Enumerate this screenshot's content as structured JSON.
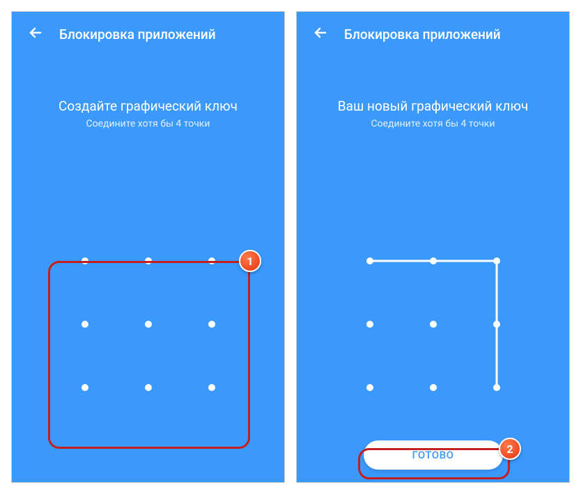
{
  "screen1": {
    "header_title": "Блокировка приложений",
    "main_title": "Создайте графический ключ",
    "subtitle": "Соедините хотя бы 4 точки"
  },
  "screen2": {
    "header_title": "Блокировка приложений",
    "main_title": "Ваш новый графический ключ",
    "subtitle": "Соедините хотя бы 4 точки",
    "done_button": "ГОТОВО"
  },
  "annotations": {
    "badge1": "1",
    "badge2": "2"
  },
  "colors": {
    "background": "#3B99FC",
    "annotation_border": "#C41E1E",
    "badge_gradient_start": "#FF7A4D",
    "badge_gradient_end": "#E63410"
  }
}
